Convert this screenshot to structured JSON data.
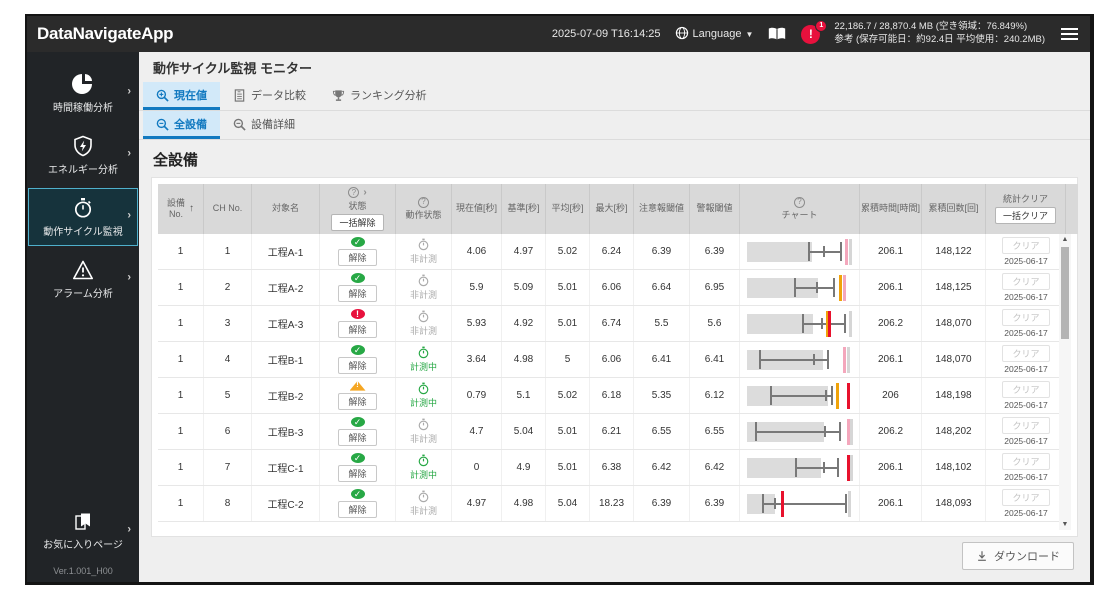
{
  "header": {
    "logo": "DataNavigateApp",
    "datetime": "2025-07-09 T16:14:25",
    "language": "Language",
    "alert_badge": "1",
    "storage_line1": "22,186.7 / 28,870.4 MB (空き領域：76.849%)",
    "storage_line2": "参考 (保存可能日：約92.4日 平均使用：240.2MB)"
  },
  "sidebar": {
    "items": [
      {
        "id": "time-operation-analysis",
        "label": "時間稼働分析",
        "active": false
      },
      {
        "id": "energy-analysis",
        "label": "エネルギー分析",
        "active": false
      },
      {
        "id": "cycle-monitoring",
        "label": "動作サイクル監視",
        "active": true
      },
      {
        "id": "alarm-analysis",
        "label": "アラーム分析",
        "active": false
      }
    ],
    "favorites": "お気に入りページ",
    "version": "Ver.1.001_H00"
  },
  "page": {
    "title": "動作サイクル監視 モニター",
    "tabs_primary": [
      {
        "label": "現在値",
        "active": true
      },
      {
        "label": "データ比較",
        "active": false
      },
      {
        "label": "ランキング分析",
        "active": false
      }
    ],
    "tabs_secondary": [
      {
        "label": "全設備",
        "active": true
      },
      {
        "label": "設備詳細",
        "active": false
      }
    ],
    "section_title": "全設備",
    "download": "ダウンロード"
  },
  "table": {
    "headers": {
      "equip_no": "設備\nNo.",
      "ch_no": "CH No.",
      "name": "対象名",
      "status": "状態",
      "batch_release": "一括解除",
      "op_state": "動作状態",
      "current": "現在値[秒]",
      "standard": "基準[秒]",
      "average": "平均[秒]",
      "max": "最大[秒]",
      "caution": "注意報閾値",
      "warning": "警報閾値",
      "chart": "チャート",
      "cum_time": "累積時間[時間]",
      "cum_count": "累積回数[回]",
      "stats_clear": "統計クリア",
      "batch_clear": "一括クリア"
    },
    "release_label": "解除",
    "clear_label": "クリア",
    "op_measuring": "計測中",
    "op_idle": "非計測",
    "status_colors": {
      "ok": "#27a845",
      "error": "#e8113d",
      "warning": "#f5a623"
    },
    "marker_colors": {
      "caution": "#f0a30a",
      "alarm": "#e8112d",
      "alarm_soft": "#f4a7bc",
      "limit": "#d6d6d6"
    },
    "rows": [
      {
        "equip_no": "1",
        "ch_no": "1",
        "name": "工程A-1",
        "status": "ok",
        "measuring": false,
        "current": "4.06",
        "standard": "4.97",
        "average": "5.02",
        "max": "6.24",
        "caution": "6.39",
        "warning": "6.39",
        "cum_time": "206.1",
        "cum_count": "148,122",
        "clear_date": "2025-06-17",
        "chart": {
          "bar_pct": 62,
          "lo_pct": 58,
          "hi_pct": 88,
          "mid_pct": 72,
          "markers": [
            {
              "pct": 93,
              "color": "#f4a7bc"
            },
            {
              "pct": 97,
              "color": "#d6d6d6"
            }
          ]
        }
      },
      {
        "equip_no": "1",
        "ch_no": "2",
        "name": "工程A-2",
        "status": "ok",
        "measuring": false,
        "current": "5.9",
        "standard": "5.09",
        "average": "5.01",
        "max": "6.06",
        "caution": "6.64",
        "warning": "6.95",
        "cum_time": "206.1",
        "cum_count": "148,125",
        "clear_date": "2025-06-17",
        "chart": {
          "bar_pct": 67,
          "lo_pct": 45,
          "hi_pct": 82,
          "mid_pct": 66,
          "markers": [
            {
              "pct": 87,
              "color": "#f0a30a"
            },
            {
              "pct": 91,
              "color": "#f4a7bc"
            }
          ]
        }
      },
      {
        "equip_no": "1",
        "ch_no": "3",
        "name": "工程A-3",
        "status": "error",
        "measuring": false,
        "current": "5.93",
        "standard": "4.92",
        "average": "5.01",
        "max": "6.74",
        "caution": "5.5",
        "warning": "5.6",
        "cum_time": "206.2",
        "cum_count": "148,070",
        "clear_date": "2025-06-17",
        "chart": {
          "bar_pct": 63,
          "lo_pct": 52,
          "hi_pct": 92,
          "mid_pct": 70,
          "markers": [
            {
              "pct": 75,
              "color": "#f0a30a"
            },
            {
              "pct": 77,
              "color": "#e8112d"
            },
            {
              "pct": 97,
              "color": "#d6d6d6"
            }
          ]
        }
      },
      {
        "equip_no": "1",
        "ch_no": "4",
        "name": "工程B-1",
        "status": "ok",
        "measuring": true,
        "current": "3.64",
        "standard": "4.98",
        "average": "5",
        "max": "6.06",
        "caution": "6.41",
        "warning": "6.41",
        "cum_time": "206.1",
        "cum_count": "148,070",
        "clear_date": "2025-06-17",
        "chart": {
          "bar_pct": 72,
          "lo_pct": 12,
          "hi_pct": 76,
          "mid_pct": 63,
          "markers": [
            {
              "pct": 91,
              "color": "#f4a7bc"
            },
            {
              "pct": 95,
              "color": "#d6d6d6"
            }
          ]
        }
      },
      {
        "equip_no": "1",
        "ch_no": "5",
        "name": "工程B-2",
        "status": "warning",
        "measuring": true,
        "current": "0.79",
        "standard": "5.1",
        "average": "5.02",
        "max": "6.18",
        "caution": "5.35",
        "warning": "6.12",
        "cum_time": "206",
        "cum_count": "148,198",
        "clear_date": "2025-06-17",
        "chart": {
          "bar_pct": 77,
          "lo_pct": 22,
          "hi_pct": 80,
          "mid_pct": 74,
          "markers": [
            {
              "pct": 84,
              "color": "#f0a30a"
            },
            {
              "pct": 95,
              "color": "#e8112d"
            }
          ]
        }
      },
      {
        "equip_no": "1",
        "ch_no": "6",
        "name": "工程B-3",
        "status": "ok",
        "measuring": false,
        "current": "4.7",
        "standard": "5.04",
        "average": "5.01",
        "max": "6.21",
        "caution": "6.55",
        "warning": "6.55",
        "cum_time": "206.2",
        "cum_count": "148,202",
        "clear_date": "2025-06-17",
        "chart": {
          "bar_pct": 73,
          "lo_pct": 8,
          "hi_pct": 87,
          "mid_pct": 73,
          "markers": [
            {
              "pct": 95,
              "color": "#f4a7bc"
            },
            {
              "pct": 98,
              "color": "#d6d6d6"
            }
          ]
        }
      },
      {
        "equip_no": "1",
        "ch_no": "7",
        "name": "工程C-1",
        "status": "ok",
        "measuring": true,
        "current": "0",
        "standard": "4.9",
        "average": "5.01",
        "max": "6.38",
        "caution": "6.42",
        "warning": "6.42",
        "cum_time": "206.1",
        "cum_count": "148,102",
        "clear_date": "2025-06-17",
        "chart": {
          "bar_pct": 70,
          "lo_pct": 46,
          "hi_pct": 85,
          "mid_pct": 72,
          "markers": [
            {
              "pct": 95,
              "color": "#e8112d"
            },
            {
              "pct": 98,
              "color": "#d6d6d6"
            }
          ]
        }
      },
      {
        "equip_no": "1",
        "ch_no": "8",
        "name": "工程C-2",
        "status": "ok",
        "measuring": false,
        "current": "4.97",
        "standard": "4.98",
        "average": "5.04",
        "max": "18.23",
        "caution": "6.39",
        "warning": "6.39",
        "cum_time": "206.1",
        "cum_count": "148,093",
        "clear_date": "2025-06-17",
        "chart": {
          "bar_pct": 27,
          "lo_pct": 15,
          "hi_pct": 93,
          "mid_pct": 26,
          "markers": [
            {
              "pct": 33,
              "color": "#e8112d"
            },
            {
              "pct": 96,
              "color": "#d6d6d6"
            }
          ]
        }
      }
    ]
  }
}
